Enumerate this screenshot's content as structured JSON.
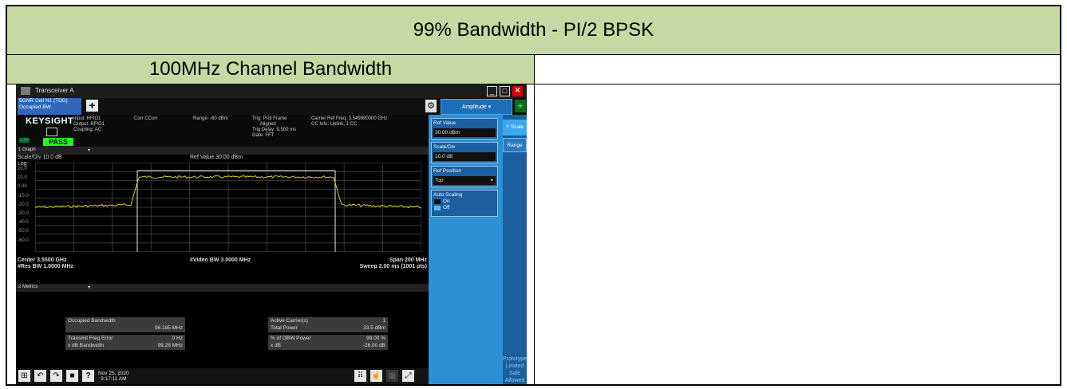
{
  "table": {
    "title": "99% Bandwidth - PI/2 BPSK",
    "col1_header": "100MHz Channel Bandwidth"
  },
  "instrument": {
    "window_title": "Transceiver A",
    "tab_label_line1": "5GNR Cell N1 (TDD)",
    "tab_label_line2": "Occupied BW",
    "brand": "KEYSIGHT",
    "status": "PASS",
    "lxi": "LXI",
    "input_info": "Input: RFIO1\nOutput: RFIO1\nCoupling: AC",
    "corr": "Corr CCorr",
    "range": "Range: -60 dBm",
    "trig": "Trig: Prot Frame\n      Aligned\nTrig Delay: 9.500 ms\nGate: FFT",
    "carrier": "Carrier Ref Freq: 3.549990000 GHz\nCC Info: Uplink, 1 CC",
    "graph_select": "1 Graph",
    "scale_div": "Scale/Div 10.0 dB",
    "log": "Log",
    "ref_value_label": "Ref Value 30.00 dBm",
    "center": "Center 3.5500 GHz",
    "res_bw": "#Res BW 1.0000 MHz",
    "video_bw": "#Video BW 3.0000 MHz",
    "span": "Span 200 MHz",
    "sweep": "Sweep 2.00 ms (1001 pts)",
    "metrics_select": "2 Metrics",
    "y_ticks": [
      "20.0",
      "10.0",
      "0.00",
      "-10.0",
      "-20.0",
      "-30.0",
      "-40.0",
      "-50.0",
      "-60.0"
    ],
    "metrics": {
      "occ_bw_label": "Occupied Bandwidth",
      "occ_bw_value": "96.185 MHz",
      "tx_freq_err_label": "Transmit Freq Error",
      "tx_freq_err_value": "0 Hz",
      "xdb_bw_label": "x dB Bandwidth",
      "xdb_bw_value": "99.28 MHz",
      "active_carriers_label": "Active Carrier(s)",
      "active_carriers_value": "1",
      "total_power_label": "Total Power",
      "total_power_value": "33.5 dBm",
      "obw_power_label": "% of OBW Power",
      "obw_power_value": "99.00 %",
      "xdb_label": "x dB",
      "xdb_value": "-26.00 dB"
    },
    "taskbar": {
      "date": "Nov 25, 2020",
      "time": "9:17:11 AM"
    },
    "side": {
      "amplitude": "Amplitude",
      "ref_value_label": "Ref Value",
      "ref_value": "30.00 dBm",
      "scale_div_label": "Scale/Div",
      "scale_div": "10.0 dB",
      "ref_position_label": "Ref Position",
      "ref_position": "Top",
      "auto_scaling_label": "Auto Scaling",
      "on": "On",
      "off": "Off",
      "y_scale": "Y Scale",
      "range": "Range",
      "prototype": "Prototype Limited Sale Allowed"
    }
  },
  "colors": {
    "header_bg": "#c6d9a2",
    "trace": "#e8e23a",
    "pass": "#1eff1e",
    "panel_blue": "#2d8fd4"
  }
}
